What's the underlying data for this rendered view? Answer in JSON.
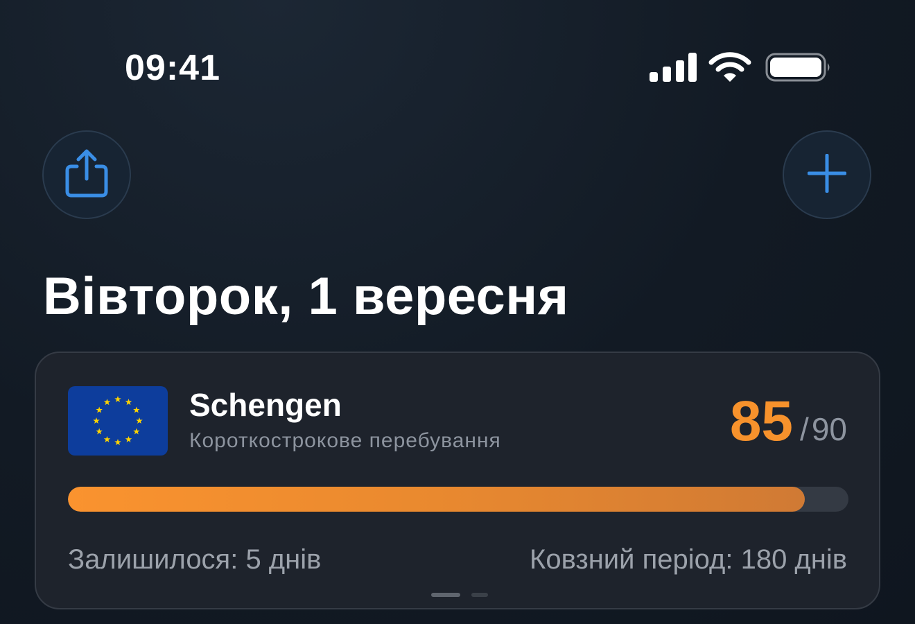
{
  "status_bar": {
    "time": "09:41",
    "icons": [
      "cellular-signal-icon",
      "wifi-icon",
      "battery-icon"
    ],
    "battery_level": 1.0
  },
  "header": {
    "share_icon": "share-icon",
    "add_icon": "plus-icon",
    "date_title": "Вівторок, 1 вересня"
  },
  "card": {
    "flag_icon": "eu-flag-icon",
    "title": "Schengen",
    "subtitle": "Короткострокове перебування",
    "used": "85",
    "separator": "/",
    "total": "90",
    "progress_fraction": 0.944,
    "remaining_text": "Залишилося: 5 днів",
    "period_text": "Ковзний період: 180 днів",
    "page_dots": {
      "count": 2,
      "active_index": 0
    }
  },
  "colors": {
    "accent_orange": "#f7922c",
    "accent_blue": "#3a8ee6",
    "eu_blue": "#0d3d9c",
    "eu_star": "#ffd400"
  }
}
